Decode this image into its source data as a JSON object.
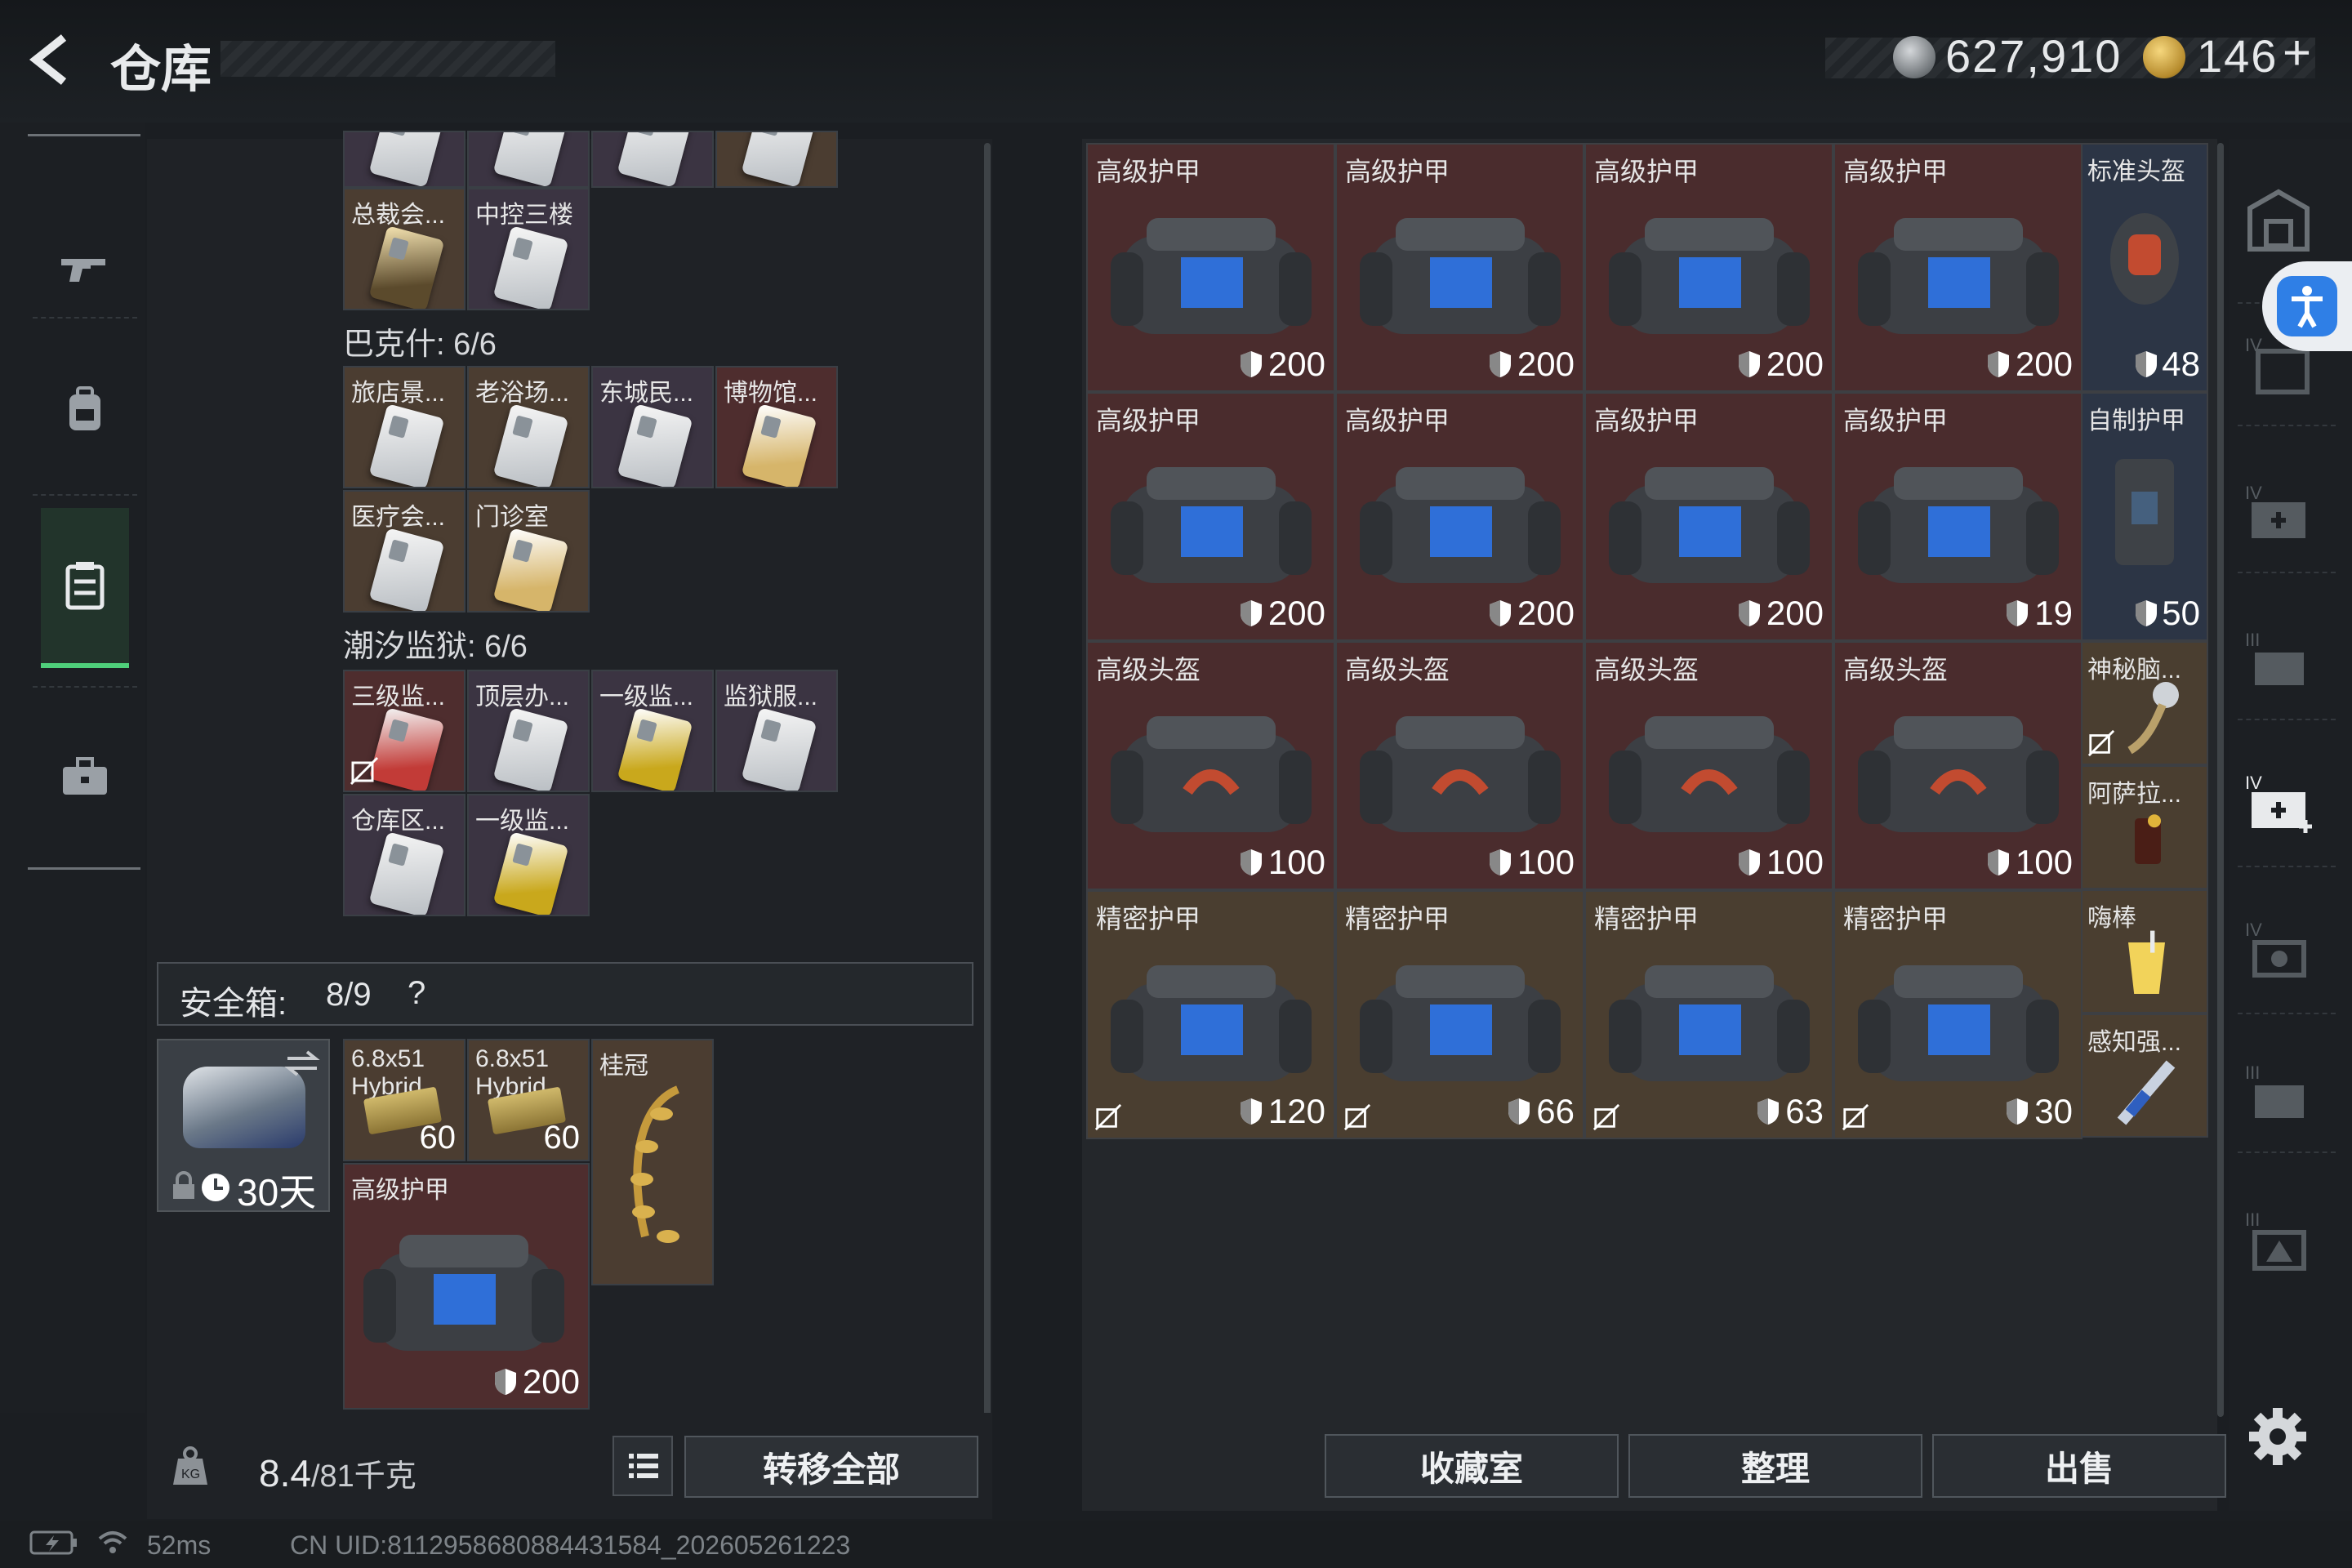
{
  "header": {
    "title": "仓库",
    "silver_amount": "627,910",
    "gold_amount": "146",
    "gold_plus": "+"
  },
  "sidebar": {
    "tabs": [
      {
        "icon": "gun-icon"
      },
      {
        "icon": "backpack-icon"
      },
      {
        "icon": "storage-icon",
        "active": true
      },
      {
        "icon": "briefcase-icon"
      }
    ]
  },
  "keycards": {
    "top_row": [
      "",
      "",
      "",
      ""
    ],
    "group1": [
      "总裁会...",
      "中控三楼"
    ],
    "section_bakesh": "巴克什: 6/6",
    "group2": [
      "旅店景...",
      "老浴场...",
      "东城民...",
      "博物馆...",
      "医疗会...",
      "门诊室"
    ],
    "section_tide": "潮汐监狱: 6/6",
    "group3": [
      "三级监...",
      "顶层办...",
      "一级监...",
      "监狱服...",
      "仓库区...",
      "一级监..."
    ]
  },
  "safe": {
    "label": "安全箱:",
    "count": "8/9",
    "help": "?",
    "days": "30天",
    "items": [
      {
        "name": "6.8x51\nHybrid",
        "count": "60"
      },
      {
        "name": "6.8x51\nHybrid",
        "count": "60"
      },
      {
        "name": "桂冠"
      },
      {
        "name": "高级护甲",
        "durability": "200"
      }
    ]
  },
  "bottom": {
    "weight_value": "8.4",
    "weight_max": "/81千克",
    "transfer_all": "转移全部"
  },
  "storage": {
    "rows": [
      [
        {
          "name": "高级护甲",
          "durability": "200",
          "bg": "red"
        },
        {
          "name": "高级护甲",
          "durability": "200",
          "bg": "red"
        },
        {
          "name": "高级护甲",
          "durability": "200",
          "bg": "red"
        },
        {
          "name": "高级护甲",
          "durability": "200",
          "bg": "red"
        }
      ],
      [
        {
          "name": "高级护甲",
          "durability": "200",
          "bg": "red"
        },
        {
          "name": "高级护甲",
          "durability": "200",
          "bg": "red"
        },
        {
          "name": "高级护甲",
          "durability": "200",
          "bg": "red"
        },
        {
          "name": "高级护甲",
          "durability": "19",
          "bg": "red"
        }
      ],
      [
        {
          "name": "高级头盔",
          "durability": "100",
          "bg": "red"
        },
        {
          "name": "高级头盔",
          "durability": "100",
          "bg": "red"
        },
        {
          "name": "高级头盔",
          "durability": "100",
          "bg": "red"
        },
        {
          "name": "高级头盔",
          "durability": "100",
          "bg": "red"
        }
      ],
      [
        {
          "name": "精密护甲",
          "durability": "120",
          "bg": "gold"
        },
        {
          "name": "精密护甲",
          "durability": "66",
          "bg": "gold"
        },
        {
          "name": "精密护甲",
          "durability": "63",
          "bg": "gold"
        },
        {
          "name": "精密护甲",
          "durability": "30",
          "bg": "gold"
        }
      ]
    ],
    "side_items": [
      {
        "name": "标准头盔",
        "durability": "48"
      },
      {
        "name": "自制护甲",
        "durability": "50"
      },
      {
        "name": "神秘脑..."
      },
      {
        "name": "阿萨拉..."
      },
      {
        "name": "嗨棒"
      },
      {
        "name": "感知强..."
      }
    ]
  },
  "actions": {
    "collection": "收藏室",
    "organize": "整理",
    "sell": "出售"
  },
  "status": {
    "ping": "52ms",
    "uid": "CN UID:8112958680884431584_202605261223"
  }
}
